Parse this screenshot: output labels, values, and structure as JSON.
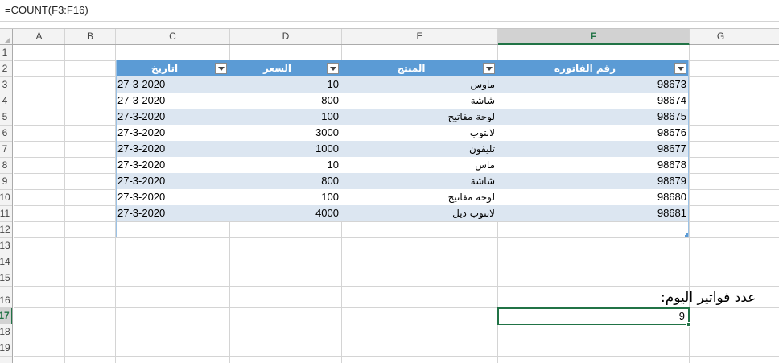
{
  "formula_bar": {
    "formula": "=COUNT(F3:F16)"
  },
  "columns": [
    "A",
    "B",
    "C",
    "D",
    "E",
    "F",
    "G"
  ],
  "selected_column": "F",
  "rows": [
    "1",
    "2",
    "3",
    "4",
    "5",
    "6",
    "7",
    "8",
    "9",
    "10",
    "11",
    "12",
    "13",
    "14",
    "15",
    "16",
    "17",
    "18",
    "19"
  ],
  "selected_row": "17",
  "table": {
    "headers": {
      "date": "اتاريخ",
      "price": "السعر",
      "product": "المنتج",
      "invoice": "رقم الفاتوره"
    },
    "rows": [
      {
        "date": "27-3-2020",
        "price": "10",
        "product": "ماوس",
        "invoice": "98673"
      },
      {
        "date": "27-3-2020",
        "price": "800",
        "product": "شاشة",
        "invoice": "98674"
      },
      {
        "date": "27-3-2020",
        "price": "100",
        "product": "لوحة مفاتيح",
        "invoice": "98675"
      },
      {
        "date": "27-3-2020",
        "price": "3000",
        "product": "لابتوب",
        "invoice": "98676"
      },
      {
        "date": "27-3-2020",
        "price": "1000",
        "product": "تليفون",
        "invoice": "98677"
      },
      {
        "date": "27-3-2020",
        "price": "10",
        "product": "ماس",
        "invoice": "98678"
      },
      {
        "date": "27-3-2020",
        "price": "800",
        "product": "شاشة",
        "invoice": "98679"
      },
      {
        "date": "27-3-2020",
        "price": "100",
        "product": "لوحة مفاتيح",
        "invoice": "98680"
      },
      {
        "date": "27-3-2020",
        "price": "4000",
        "product": "لابتوب ديل",
        "invoice": "98681"
      }
    ]
  },
  "summary": {
    "label": "عدد فواتير اليوم:",
    "count_value": "9"
  },
  "colors": {
    "table_header": "#5b9bd5",
    "band": "#dce6f1",
    "accent": "#217346"
  }
}
